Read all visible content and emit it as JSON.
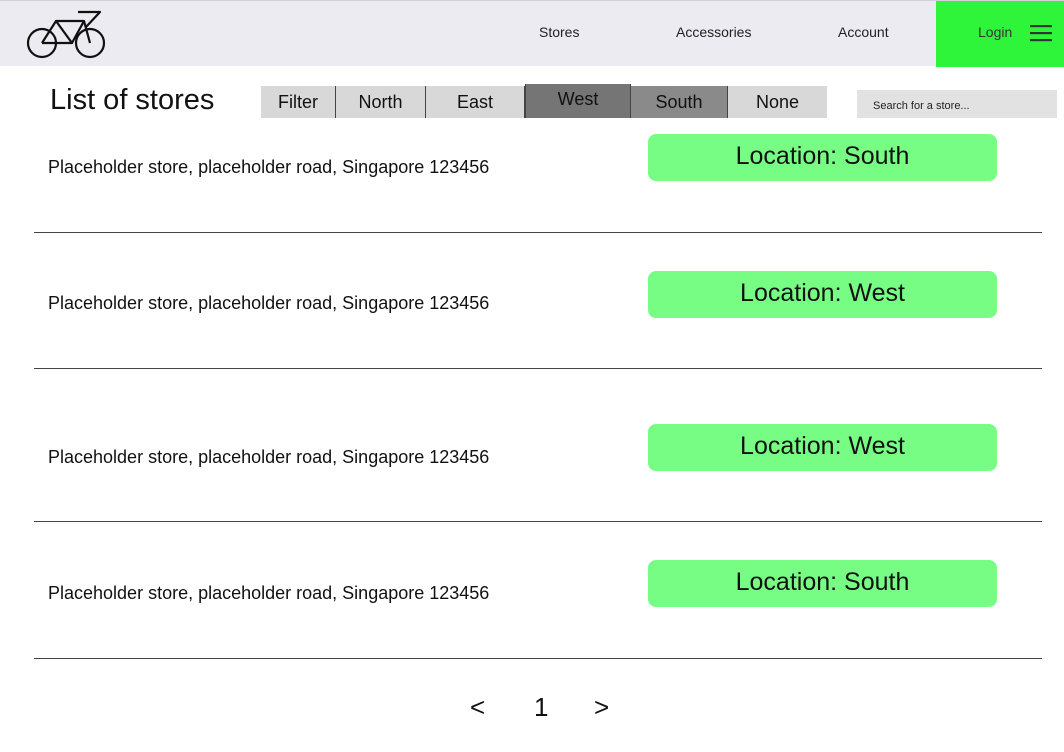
{
  "header": {
    "logo_icon": "bicycle-icon",
    "nav": {
      "stores": "Stores",
      "accessories": "Accessories",
      "account": "Account"
    },
    "login_label": "Login",
    "menu_icon": "hamburger-menu-icon",
    "login_bg_color": "#2ff53a"
  },
  "main": {
    "title": "List of stores",
    "filters": {
      "filter_label": "Filter",
      "north": "North",
      "east": "East",
      "west": "West",
      "south": "South",
      "none": "None"
    },
    "search": {
      "placeholder": "Search for a store..."
    },
    "stores": [
      {
        "address": "Placeholder store, placeholder road, Singapore 123456",
        "location": "Location: South"
      },
      {
        "address": "Placeholder store, placeholder road, Singapore 123456",
        "location": "Location: West"
      },
      {
        "address": "Placeholder store, placeholder road, Singapore 123456",
        "location": "Location: West"
      },
      {
        "address": "Placeholder store, placeholder road, Singapore 123456",
        "location": "Location: South"
      }
    ],
    "badge_color": "#77fd83"
  },
  "pagination": {
    "prev": "<",
    "page": "1",
    "next": ">"
  }
}
